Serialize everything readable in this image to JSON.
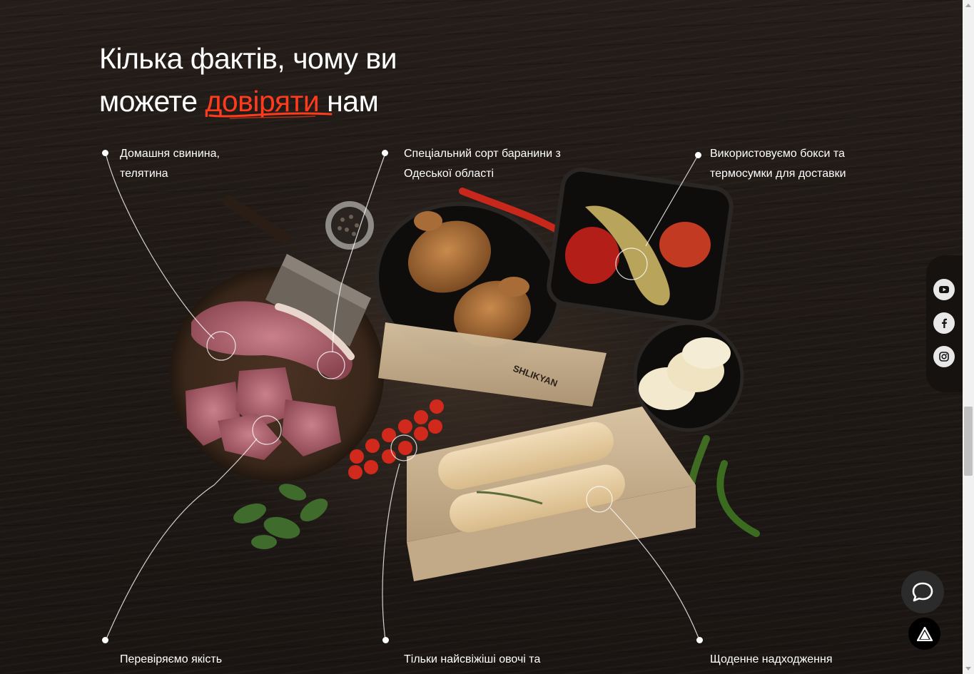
{
  "heading": {
    "line1": "Кілька фактів, чому ви",
    "line2_before": "можете ",
    "line2_accent": "довіряти",
    "line2_after": " нам"
  },
  "facts_top": [
    {
      "line1": "Домашня свинина,",
      "line2": "телятина"
    },
    {
      "line1": "Спеціальний сорт баранини з",
      "line2": "Одеської області"
    },
    {
      "line1": "Використовуємо бокси та",
      "line2": "термосумки для доставки"
    }
  ],
  "facts_bottom": [
    {
      "line1": "Перевіряємо якість"
    },
    {
      "line1": "Тільки найсвіжіші овочі та"
    },
    {
      "line1": "Щоденне надходження"
    }
  ],
  "brand_on_bag": "SHLIKYAN",
  "social": [
    {
      "icon": "youtube-icon"
    },
    {
      "icon": "facebook-icon"
    },
    {
      "icon": "instagram-icon"
    }
  ],
  "colors": {
    "accent": "#ff3b1d",
    "background": "#1f1916"
  }
}
